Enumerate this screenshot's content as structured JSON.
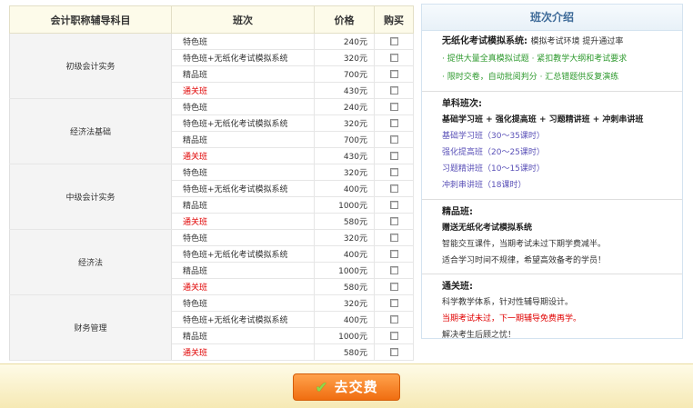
{
  "table": {
    "headers": [
      "会计职称辅导科目",
      "班次",
      "价格",
      "购买"
    ],
    "groups": [
      {
        "subject": "初级会计实务",
        "rows": [
          {
            "name": "特色班",
            "price": "240元",
            "red": false
          },
          {
            "name": "特色班+无纸化考试模拟系统",
            "price": "320元",
            "red": false
          },
          {
            "name": "精品班",
            "price": "700元",
            "red": false
          },
          {
            "name": "通关班",
            "price": "430元",
            "red": true
          }
        ]
      },
      {
        "subject": "经济法基础",
        "rows": [
          {
            "name": "特色班",
            "price": "240元",
            "red": false
          },
          {
            "name": "特色班+无纸化考试模拟系统",
            "price": "320元",
            "red": false
          },
          {
            "name": "精品班",
            "price": "700元",
            "red": false
          },
          {
            "name": "通关班",
            "price": "430元",
            "red": true
          }
        ]
      },
      {
        "subject": "中级会计实务",
        "rows": [
          {
            "name": "特色班",
            "price": "320元",
            "red": false
          },
          {
            "name": "特色班+无纸化考试模拟系统",
            "price": "400元",
            "red": false
          },
          {
            "name": "精品班",
            "price": "1000元",
            "red": false
          },
          {
            "name": "通关班",
            "price": "580元",
            "red": true
          }
        ]
      },
      {
        "subject": "经济法",
        "rows": [
          {
            "name": "特色班",
            "price": "320元",
            "red": false
          },
          {
            "name": "特色班+无纸化考试模拟系统",
            "price": "400元",
            "red": false
          },
          {
            "name": "精品班",
            "price": "1000元",
            "red": false
          },
          {
            "name": "通关班",
            "price": "580元",
            "red": true
          }
        ]
      },
      {
        "subject": "财务管理",
        "rows": [
          {
            "name": "特色班",
            "price": "320元",
            "red": false
          },
          {
            "name": "特色班+无纸化考试模拟系统",
            "price": "400元",
            "red": false
          },
          {
            "name": "精品班",
            "price": "1000元",
            "red": false
          },
          {
            "name": "通关班",
            "price": "580元",
            "red": true
          }
        ]
      }
    ]
  },
  "intro": {
    "title": "班次介绍",
    "paperless": {
      "heading": "无纸化考试模拟系统:",
      "heading_extra": "模拟考试环境 提升通过率",
      "bullet1": "· 提供大量全真模拟试题 · 紧扣教学大纲和考试要求",
      "bullet2": "· 限时交卷，自动批阅判分 · 汇总错题供反复演练"
    },
    "single": {
      "heading": "单科班次:",
      "summary": "基础学习班 + 强化提高班 + 习题精讲班 + 冲刺串讲班",
      "items": [
        "基础学习班（30～35课时）",
        "强化提高班（20～25课时）",
        "习题精讲班（10～15课时）",
        "冲刺串讲班（18课时）"
      ]
    },
    "premium": {
      "heading": "精品班:",
      "line1": "赠送无纸化考试模拟系统",
      "line2": "智能交互课件，当期考试未过下期学费减半。",
      "line3": "适合学习时间不规律，希望高效备考的学员！"
    },
    "pass": {
      "heading": "通关班:",
      "line1": "科学教学体系，针对性辅导期设计。",
      "line2": "当期考试未过，下一期辅导免费再学。",
      "line3": "解决考生后顾之忧！"
    }
  },
  "footer": {
    "pay_label": "去交费"
  },
  "colors": {
    "accent_orange": "#f06d10",
    "red": "#e00000",
    "green": "#2f9a2f",
    "purple": "#5b52b8",
    "title_blue": "#3d6a98"
  }
}
